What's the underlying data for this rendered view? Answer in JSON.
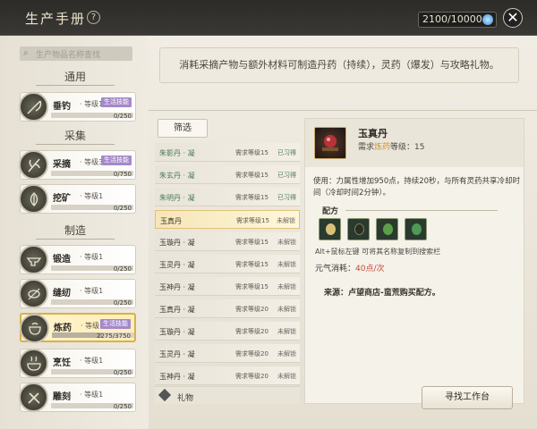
{
  "header": {
    "title": "生产手册",
    "help": "?",
    "currency": "2100/10000",
    "close": "✕"
  },
  "search": {
    "placeholder": "生产物品名称查找",
    "icon": "search-icon"
  },
  "sections": [
    {
      "label": "通用"
    },
    {
      "label": "采集"
    },
    {
      "label": "制造"
    }
  ],
  "skills": [
    {
      "name": "垂钓",
      "level": "· 等级1",
      "tag": "生活技能",
      "exp": "0/250",
      "progress": 0
    },
    {
      "name": "采摘",
      "level": "· 等级3",
      "tag": "生活技能",
      "exp": "0/750",
      "progress": 0
    },
    {
      "name": "挖矿",
      "level": "· 等级1",
      "tag": "",
      "exp": "0/250",
      "progress": 0
    },
    {
      "name": "锻造",
      "level": "· 等级1",
      "tag": "",
      "exp": "0/250",
      "progress": 0
    },
    {
      "name": "缝纫",
      "level": "· 等级1",
      "tag": "",
      "exp": "0/250",
      "progress": 0
    },
    {
      "name": "炼药",
      "level": "· 等级16",
      "tag": "生活技能",
      "exp": "2275/3750",
      "progress": 0.607
    },
    {
      "name": "烹饪",
      "level": "· 等级1",
      "tag": "",
      "exp": "0/250",
      "progress": 0
    },
    {
      "name": "雕刻",
      "level": "· 等级1",
      "tag": "",
      "exp": "0/250",
      "progress": 0
    }
  ],
  "description": "消耗采摘产物与额外材料可制造丹药（持续），灵药（爆发）与攻略礼物。",
  "filter_label": "筛选",
  "recipes": [
    {
      "name": "朱影丹 · 凝",
      "req": "需求等级15",
      "status": "已习得",
      "learned": true
    },
    {
      "name": "朱玄丹 · 凝",
      "req": "需求等级15",
      "status": "已习得",
      "learned": true
    },
    {
      "name": "朱明丹 · 凝",
      "req": "需求等级15",
      "status": "已习得",
      "learned": true
    },
    {
      "name": "玉真丹",
      "req": "需求等级15",
      "status": "未解锁",
      "learned": false
    },
    {
      "name": "玉璇丹 · 凝",
      "req": "需求等级15",
      "status": "未解锁",
      "learned": false
    },
    {
      "name": "玉灵丹 · 凝",
      "req": "需求等级15",
      "status": "未解锁",
      "learned": false
    },
    {
      "name": "玉神丹 · 凝",
      "req": "需求等级15",
      "status": "未解锁",
      "learned": false
    },
    {
      "name": "玉真丹 · 凝",
      "req": "需求等级20",
      "status": "未解锁",
      "learned": false
    },
    {
      "name": "玉璇丹 · 凝",
      "req": "需求等级20",
      "status": "未解锁",
      "learned": false
    },
    {
      "name": "玉灵丹 · 凝",
      "req": "需求等级20",
      "status": "未解锁",
      "learned": false
    },
    {
      "name": "玉神丹 · 凝",
      "req": "需求等级20",
      "status": "未解锁",
      "learned": false
    }
  ],
  "gift_label": "礼物",
  "detail": {
    "name": "玉真丹",
    "req_prefix": "需求",
    "req_skill": "炼药",
    "req_suffix": "等级：15",
    "effect": "使用：力属性增加950点，持续20秒，与所有灵药共享冷却时间（冷却时间2分钟）。",
    "formula_title": "配方",
    "ingredient_icons": [
      "seeds-icon",
      "herb-icon",
      "leaf-icon",
      "leaf-icon"
    ],
    "alt_text": "Alt+鼠标左键 可将其名称复制到搜索栏",
    "energy_label": "元气消耗：",
    "energy_value": "40点/次",
    "source": "来源：卢望商店-蛮荒购买配方。"
  },
  "find_button": "寻找工作台",
  "colors": {
    "accent": "#d9b04c",
    "tag": "#a489c9",
    "learned": "#4c7a57",
    "energy": "#c34b3c"
  }
}
